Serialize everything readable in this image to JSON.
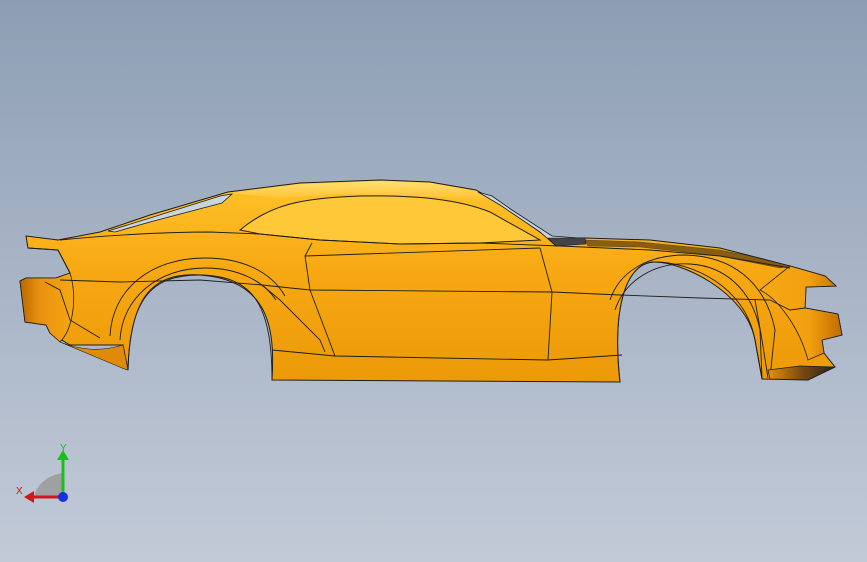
{
  "model": {
    "name": "car-body",
    "body_color": "#f2a20c",
    "shade_color": "#c87400",
    "highlight_color": "#ffd040",
    "edge_color": "#1e1e1e",
    "glass_color": "#c8d4de"
  },
  "background": {
    "top_color": "#8d9eb4",
    "bottom_color": "#c2cad7"
  },
  "triad": {
    "x_label": "X",
    "y_label": "Y",
    "x_color": "#d01818",
    "y_color": "#18c018",
    "z_color": "#1830e0"
  }
}
